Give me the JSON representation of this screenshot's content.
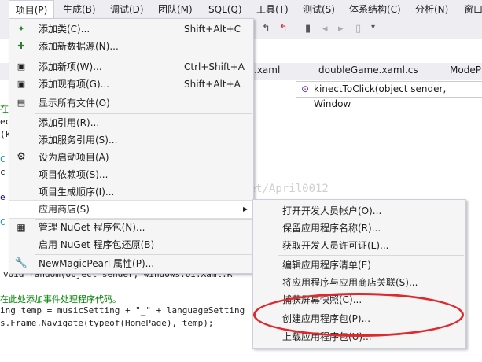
{
  "menubar": {
    "items": [
      "项目(P)",
      "生成(B)",
      "调试(D)",
      "团队(M)",
      "SQL(Q)",
      "工具(T)",
      "测试(S)",
      "体系结构(C)",
      "分析(N)",
      "窗口"
    ]
  },
  "tabs": [
    ".xaml",
    "doubleGame.xaml.cs",
    "ModeP"
  ],
  "navbar": {
    "method": "kinectToClick(object sender, Window"
  },
  "project_menu": {
    "items": [
      {
        "label": "添加类(C)...",
        "shortcut": "Shift+Alt+C",
        "icon": "add-class-icon"
      },
      {
        "label": "添加新数据源(N)...",
        "shortcut": "",
        "icon": "add-datasource-icon"
      },
      {
        "label": "添加新项(W)...",
        "shortcut": "Ctrl+Shift+A",
        "icon": "add-new-item-icon"
      },
      {
        "label": "添加现有项(G)...",
        "shortcut": "Shift+Alt+A",
        "icon": "add-existing-item-icon"
      },
      {
        "label": "显示所有文件(O)",
        "shortcut": "",
        "icon": "show-all-files-icon"
      },
      {
        "label": "添加引用(R)...",
        "shortcut": "",
        "icon": ""
      },
      {
        "label": "添加服务引用(S)...",
        "shortcut": "",
        "icon": ""
      },
      {
        "label": "设为启动项目(A)",
        "shortcut": "",
        "icon": "gear-icon"
      },
      {
        "label": "项目依赖项(S)...",
        "shortcut": "",
        "icon": ""
      },
      {
        "label": "项目生成顺序(I)...",
        "shortcut": "",
        "icon": ""
      },
      {
        "label": "应用商店(S)",
        "shortcut": "",
        "icon": ""
      },
      {
        "label": "管理 NuGet 程序包(N)...",
        "shortcut": "",
        "icon": "nuget-icon"
      },
      {
        "label": "启用 NuGet 程序包还原(B)",
        "shortcut": "",
        "icon": ""
      },
      {
        "label": "NewMagicPearl 属性(P)...",
        "shortcut": "",
        "icon": "wrench-icon"
      }
    ]
  },
  "store_submenu": {
    "items": [
      "打开开发人员帐户(O)...",
      "保留应用程序名称(R)...",
      "获取开发人员许可证(L)...",
      "编辑应用程序清单(E)",
      "将应用程序与应用商店关联(S)...",
      "捕获屏幕快照(C)...",
      "创建应用程序包(P)...",
      "上载应用程序包(U)..."
    ]
  },
  "code_lines": {
    "l1": "在",
    "l2": "ec",
    "l3": "(k",
    "l4": "C",
    "l5": "c",
    "l6": "e",
    "l7": "C",
    "l8": "void random(object sender, windows.UI.Xaml.R",
    "l9": "在此处添加事件处理程序代码。",
    "l10": "ing temp = musicSetting + \"_\" + languageSetting",
    "l11": "s.Frame.Navigate(typeof(HomePage), temp);"
  },
  "watermark": "http://blog.csdn.net/April0012",
  "colors": {
    "highlight_ellipse": "#e0282d",
    "accent": "#007acc"
  }
}
